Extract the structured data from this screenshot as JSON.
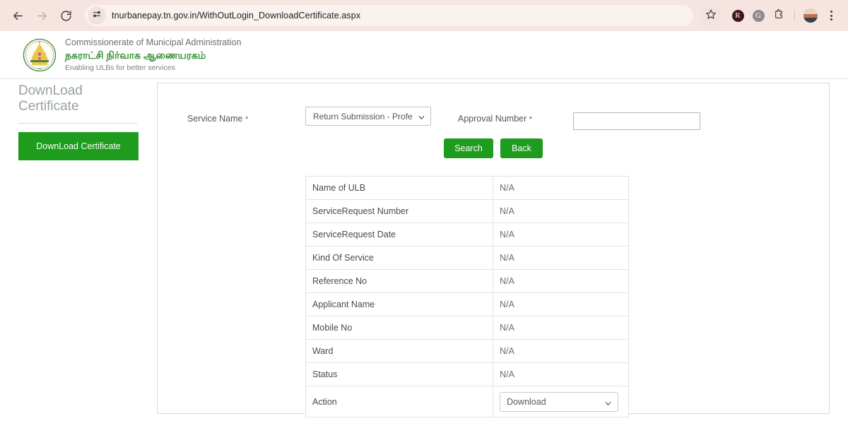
{
  "browser": {
    "url": "tnurbanepay.tn.gov.in/WithOutLogin_DownloadCertificate.aspx",
    "back_icon": "back-arrow-icon",
    "forward_icon": "forward-arrow-icon",
    "reload_icon": "reload-icon",
    "site_settings_icon": "tune-sliders-icon",
    "bookmark_icon": "star-icon",
    "extension_r_label": "R",
    "extension_g_label": "G",
    "extensions_icon": "puzzle-piece-icon",
    "menu_icon": "three-dot-menu-icon",
    "avatar_icon": "profile-avatar"
  },
  "header": {
    "emblem_icon": "tamil-nadu-state-emblem",
    "org_english": "Commissionerate of Municipal Administration",
    "org_tamil": "நகராட்சி நிர்வாக ஆணையரகம்",
    "tagline": "Enabling ULBs for better services"
  },
  "sidebar": {
    "title": "DownLoad Certificate",
    "button_label": "DownLoad Certificate"
  },
  "form": {
    "service_name_label": "Service Name",
    "required_mark": "*",
    "service_name_value": "Return Submission - Profe",
    "service_name_options": [
      "Return Submission - Profe"
    ],
    "approval_number_label": "Approval Number",
    "approval_number_value": "",
    "approval_number_placeholder": "",
    "search_button": "Search",
    "back_button": "Back",
    "dropdown_icon": "chevron-down-icon"
  },
  "result": {
    "rows": [
      {
        "key": "Name of ULB",
        "value": "N/A"
      },
      {
        "key": "ServiceRequest Number",
        "value": "N/A"
      },
      {
        "key": "ServiceRequest Date",
        "value": "N/A"
      },
      {
        "key": "Kind Of Service",
        "value": "N/A"
      },
      {
        "key": "Reference No",
        "value": "N/A"
      },
      {
        "key": "Applicant Name",
        "value": "N/A"
      },
      {
        "key": "Mobile No",
        "value": "N/A"
      },
      {
        "key": "Ward",
        "value": "N/A"
      },
      {
        "key": "Status",
        "value": "N/A"
      }
    ],
    "action_label": "Action",
    "action_value": "Download",
    "action_options": [
      "Download"
    ]
  },
  "colors": {
    "brand_green": "#1e9c1e",
    "tamil_green": "#2f8f2f",
    "panel_border": "#cfe0cf",
    "toolbar_bg": "#f6e4e1"
  }
}
